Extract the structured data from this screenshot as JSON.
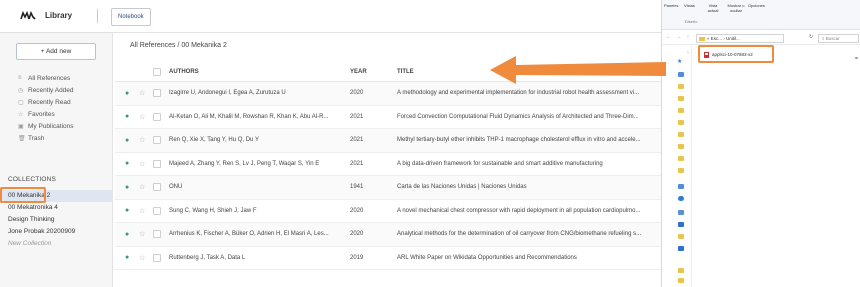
{
  "header": {
    "app_title": "Library",
    "notebook_label": "Notebook"
  },
  "sidebar": {
    "add_label": "+ Add new",
    "nav": [
      {
        "icon": "≡",
        "label": "All References"
      },
      {
        "icon": "◷",
        "label": "Recently Added"
      },
      {
        "icon": "▢",
        "label": "Recently Read"
      },
      {
        "icon": "☆",
        "label": "Favorites"
      },
      {
        "icon": "▣",
        "label": "My Publications"
      },
      {
        "icon": "🗑",
        "label": "Trash"
      }
    ],
    "collections_header": "COLLECTIONS",
    "collections": [
      {
        "label": "00 Mekanika 2",
        "active": true
      },
      {
        "label": "00 Mekatronika 4",
        "active": false
      },
      {
        "label": "Design Thinking",
        "active": false
      },
      {
        "label": "Jone Probak 20200909",
        "active": false
      }
    ],
    "new_collection_label": "New Collection"
  },
  "main": {
    "breadcrumb": "All References / 00 Mekanika 2",
    "columns": {
      "authors": "AUTHORS",
      "year": "YEAR",
      "title": "TITLE"
    },
    "rows": [
      {
        "dot": "●",
        "authors": "Izagirre U, Andonegui I, Egea A, Zurutuza U",
        "year": "2020",
        "title": "A methodology and experimental implementation for industrial robot health assessment vi..."
      },
      {
        "dot": "●",
        "authors": "Al-Ketan O, Ali M, Khalil M, Rowshan R, Khan K, Abu Al-R...",
        "year": "2021",
        "title": "Forced Convection Computational Fluid Dynamics Analysis of Architected and Three-Dim..."
      },
      {
        "dot": "●",
        "authors": "Ren Q, Xie X, Tang Y, Hu Q, Du Y",
        "year": "2021",
        "title": "Methyl tertiary-butyl ether inhibits THP-1 macrophage cholesterol efflux in vitro and accele..."
      },
      {
        "dot": "●",
        "authors": "Majeed A, Zhang Y, Ren S, Lv J, Peng T, Waqar S, Yin E",
        "year": "2021",
        "title": "A big data-driven framework for sustainable and smart additive manufacturing"
      },
      {
        "dot": "●",
        "authors": "ONU",
        "year": "1941",
        "title": "Carta de las Naciones Unidas | Naciones Unidas"
      },
      {
        "dot": "●",
        "authors": "Sung C, Wang H, Shieh J, Jaw F",
        "year": "2020",
        "title": "A novel mechanical chest compressor with rapid deployment in all population cardiopulmo..."
      },
      {
        "dot": "●",
        "authors": "Arrhenius K, Fischer A, Büker O, Adrien H, El Masri A, Les...",
        "year": "2020",
        "title": "Analytical methods for the determination of oil carryover from CNG/biomethane refueling s..."
      },
      {
        "dot": "●",
        "authors": "Ruttenberg J, Task A, Data L",
        "year": "2019",
        "title": "ARL White Paper on Wikidata Opportunities and Recommendations"
      }
    ]
  },
  "explorer": {
    "ribbon_buttons": [
      {
        "label": "Paneles"
      },
      {
        "label": "Vistas"
      },
      {
        "label": "Vista actual"
      },
      {
        "label": "Mostrar u ocultar"
      },
      {
        "label": "Opciones"
      }
    ],
    "ribbon_group": "Diseño",
    "address": "« Esc... › Unitil...",
    "search_placeholder": "Buscar",
    "file_name": "applsci-10-07883-v2"
  },
  "colors": {
    "accent_orange": "#f08a3c",
    "green_dot": "#3a9a6c",
    "active_collection": "#dfe6f2"
  }
}
